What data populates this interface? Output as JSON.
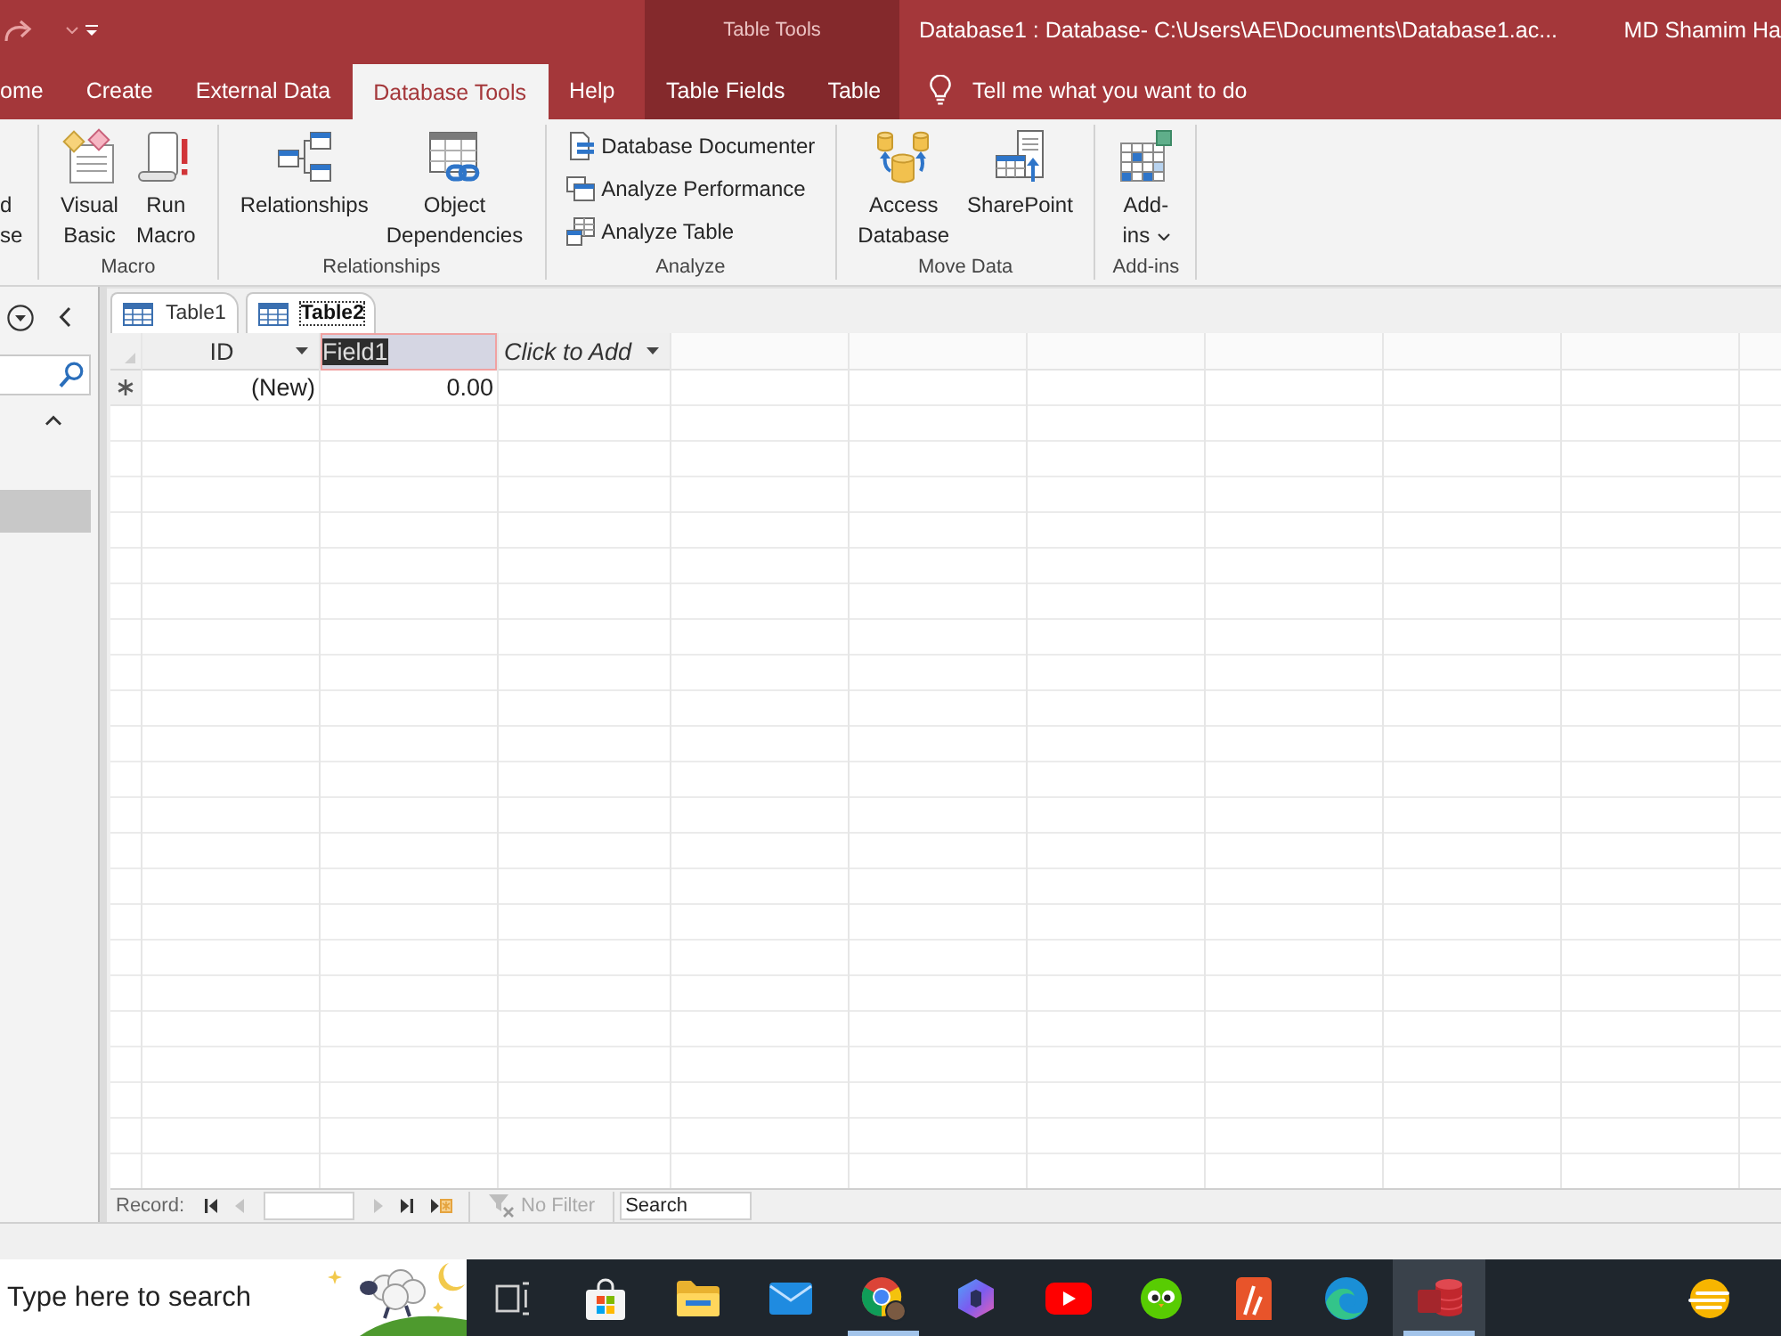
{
  "title_bar": {
    "title": "Database1 : Database- C:\\Users\\AE\\Documents\\Database1.ac...",
    "user": "MD Shamim Ha"
  },
  "ribbon_tabs": [
    {
      "label": "ome",
      "selected": false
    },
    {
      "label": "Create",
      "selected": false
    },
    {
      "label": "External Data",
      "selected": false
    },
    {
      "label": "Database Tools",
      "selected": true
    },
    {
      "label": "Help",
      "selected": false
    }
  ],
  "context_tabs": {
    "label": "Table Tools",
    "tabs": [
      {
        "label": "Table Fields",
        "selected": false
      },
      {
        "label": "Table",
        "selected": false
      }
    ]
  },
  "tell_me": "Tell me what you want to do",
  "ribbon_groups": [
    {
      "clipped": true,
      "buttons": [
        {
          "kind": "large",
          "lines": [
            "d",
            "se"
          ]
        }
      ]
    },
    {
      "label": "Macro",
      "buttons": [
        {
          "kind": "large",
          "lines": [
            "Visual",
            "Basic"
          ]
        },
        {
          "kind": "large",
          "lines": [
            "Run",
            "Macro"
          ]
        }
      ]
    },
    {
      "label": "Relationships",
      "buttons": [
        {
          "kind": "large",
          "lines": [
            "Relationships"
          ]
        },
        {
          "kind": "large",
          "lines": [
            "Object",
            "Dependencies"
          ]
        }
      ]
    },
    {
      "label": "Analyze",
      "buttons": [
        {
          "kind": "small",
          "label": "Database Documenter"
        },
        {
          "kind": "small",
          "label": "Analyze Performance"
        },
        {
          "kind": "small",
          "label": "Analyze Table"
        }
      ]
    },
    {
      "label": "Move Data",
      "buttons": [
        {
          "kind": "large",
          "lines": [
            "Access",
            "Database"
          ]
        },
        {
          "kind": "large",
          "lines": [
            "SharePoint"
          ]
        }
      ]
    },
    {
      "label": "Add-ins",
      "buttons": [
        {
          "kind": "large",
          "lines": [
            "Add-",
            "ins"
          ],
          "dropdown": true
        }
      ]
    }
  ],
  "nav_pane": {
    "group_expanded": true,
    "items": [
      {
        "selected": true
      }
    ]
  },
  "document_tabs": [
    {
      "label": "Table1",
      "selected": false
    },
    {
      "label": "Table2",
      "selected": true
    }
  ],
  "datasheet": {
    "columns": [
      {
        "kind": "field",
        "label": "ID",
        "selected": false,
        "editing": false,
        "dropdown": true
      },
      {
        "kind": "field",
        "label": "Field1",
        "selected": true,
        "editing": true,
        "dropdown": false
      },
      {
        "kind": "add",
        "label": "Click to Add",
        "selected": false,
        "editing": false,
        "dropdown": true
      }
    ],
    "rows": [
      {
        "new_record": true,
        "cells": [
          "(New)",
          "0.00"
        ]
      }
    ]
  },
  "record_nav": {
    "label": "Record:",
    "buttons": [
      {
        "kind": "first",
        "disabled": false
      },
      {
        "kind": "previous",
        "disabled": true
      },
      {
        "kind": "next",
        "disabled": true
      },
      {
        "kind": "last",
        "disabled": false
      },
      {
        "kind": "new",
        "disabled": false
      }
    ],
    "filter": {
      "label": "No Filter",
      "disabled": true
    },
    "search": {
      "placeholder": "Search"
    }
  },
  "taskbar": {
    "search": {
      "placeholder": "Type here to search"
    },
    "apps": [
      {
        "running": false,
        "selected": false
      },
      {
        "running": false,
        "selected": false
      },
      {
        "running": false,
        "selected": false
      },
      {
        "running": false,
        "selected": false
      },
      {
        "running": true,
        "selected": false
      },
      {
        "running": false,
        "selected": false
      },
      {
        "running": false,
        "selected": false
      },
      {
        "running": false,
        "selected": false
      },
      {
        "running": false,
        "selected": false
      },
      {
        "running": false,
        "selected": false
      },
      {
        "running": true,
        "selected": true
      }
    ]
  }
}
